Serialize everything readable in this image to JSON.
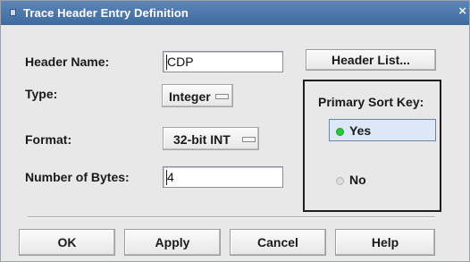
{
  "window": {
    "title": "Trace Header Entry Definition",
    "close_glyph": "×"
  },
  "form": {
    "header_name_label": "Header Name:",
    "header_name_value": "CDP",
    "type_label": "Type:",
    "type_value": "Integer",
    "format_label": "Format:",
    "format_value": "32-bit INT",
    "bytes_label": "Number of Bytes:",
    "bytes_value": "4",
    "header_list_button": "Header List..."
  },
  "sort_key": {
    "label": "Primary Sort Key:",
    "options": [
      {
        "label": "Yes",
        "selected": true
      },
      {
        "label": "No",
        "selected": false
      }
    ],
    "selected_color": "#22cc33"
  },
  "buttons": {
    "ok": "OK",
    "apply": "Apply",
    "cancel": "Cancel",
    "help": "Help"
  },
  "colors": {
    "titlebar": "#4a76aa",
    "dialog_bg": "#e8e8e8"
  }
}
